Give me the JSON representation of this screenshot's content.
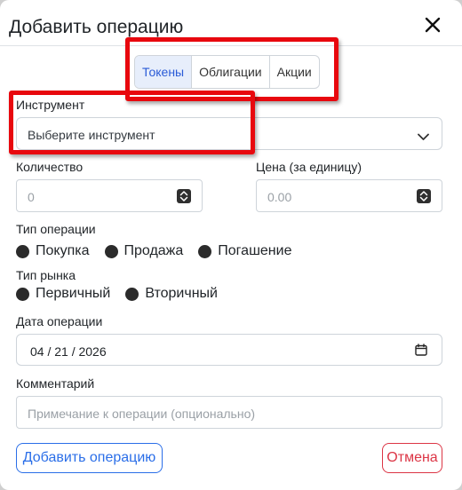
{
  "modal": {
    "title": "Добавить операцию",
    "close_icon": "close-icon"
  },
  "tabs": [
    {
      "label": "Токены",
      "active": true
    },
    {
      "label": "Облигации",
      "active": false
    },
    {
      "label": "Акции",
      "active": false
    }
  ],
  "instrument": {
    "label": "Инструмент",
    "value": "Выберите инструмент"
  },
  "quantity": {
    "label": "Количество",
    "placeholder": "0"
  },
  "price": {
    "label": "Цена (за единицу)",
    "placeholder": "0.00"
  },
  "operation_type": {
    "label": "Тип операции",
    "options": [
      "Покупка",
      "Продажа",
      "Погашение"
    ]
  },
  "market_type": {
    "label": "Тип рынка",
    "options": [
      "Первичный",
      "Вторичный"
    ]
  },
  "operation_date": {
    "label": "Дата операции",
    "value": "04 / 21 / 2026"
  },
  "comment": {
    "label": "Комментарий",
    "placeholder": "Примечание к операции (опционально)"
  },
  "buttons": {
    "submit": "Добавить операцию",
    "cancel": "Отмена"
  },
  "colors": {
    "accent": "#2a6ee8",
    "danger": "#dc3545",
    "highlight": "#e8080e",
    "active_tab_bg": "#e7eefb"
  }
}
